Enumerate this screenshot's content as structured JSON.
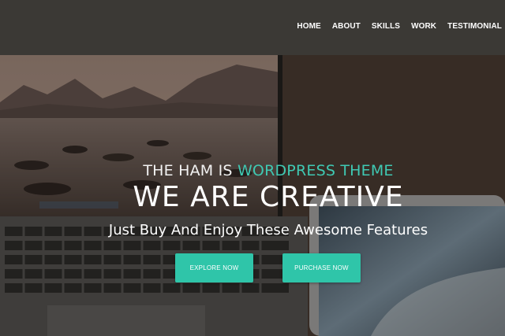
{
  "nav": {
    "items": [
      {
        "label": "HOME"
      },
      {
        "label": "ABOUT"
      },
      {
        "label": "SKILLS"
      },
      {
        "label": "WORK"
      },
      {
        "label": "TESTIMONIAL"
      }
    ]
  },
  "hero": {
    "prefix": "THE HAM IS",
    "highlight": "WORDPRESS THEME",
    "heading": "WE ARE CREATIVE",
    "subheading": "Just Buy And Enjoy These Awesome Features",
    "explore_label": "EXPLORE NOW",
    "purchase_label": "PURCHASE NOW"
  },
  "colors": {
    "accent": "#3fc9b3",
    "button": "#2fc5a9",
    "navbar": "#3b3935"
  }
}
